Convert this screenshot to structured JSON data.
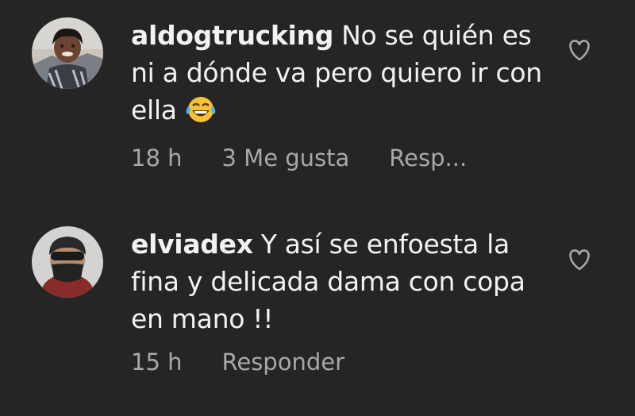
{
  "comments": [
    {
      "username": "aldogtrucking",
      "text": "No se quién es ni a dónde va pero quiero ir con ella",
      "emoji_icon": "face-with-tears-of-joy-icon",
      "time": "18 h",
      "likes": "3 Me gusta",
      "reply": "Resp..."
    },
    {
      "username": "elviadex",
      "text": "Y así se enfoesta la fina y delicada dama con copa en mano !!",
      "time": "15 h",
      "reply": "Responder"
    }
  ],
  "colors": {
    "background": "#252525",
    "text": "#f2f2f2",
    "meta": "#a8a8a8"
  }
}
